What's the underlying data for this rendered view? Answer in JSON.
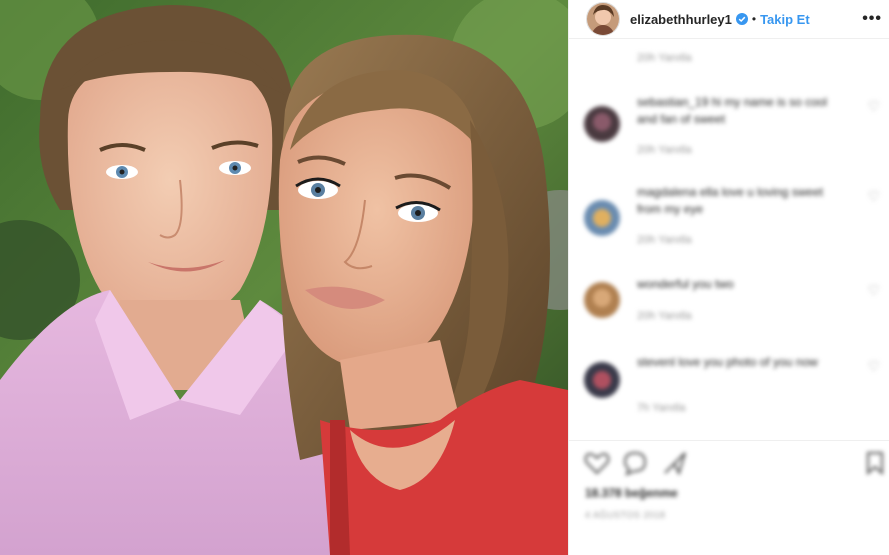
{
  "post": {
    "username": "elizabethhurley1",
    "follow_label": "Takip Et",
    "separator": "•",
    "more_label": "•••"
  },
  "comments": [
    {
      "meta": "20h Yanıtla"
    },
    {
      "text": "sebastian_19 hi my name is so cool and fan of sweet",
      "meta": "20h Yanıtla"
    },
    {
      "text": "magdalena ella love u loving sweet from my eye",
      "meta": "20h Yanıtla"
    },
    {
      "text": "wonderful you two",
      "meta": "20h Yanıtla"
    },
    {
      "text": "stevenl love you photo of you now",
      "meta": "7h Yanıtla"
    }
  ],
  "likes_label": "18.378 beğenme",
  "date_label": "4 AĞUSTOS 2018",
  "colors": {
    "accent": "#3897f0",
    "text": "#262626",
    "muted": "#999999"
  },
  "icons": [
    "verified-badge-icon",
    "heart-icon",
    "comment-icon",
    "share-icon",
    "bookmark-icon",
    "more-icon"
  ]
}
